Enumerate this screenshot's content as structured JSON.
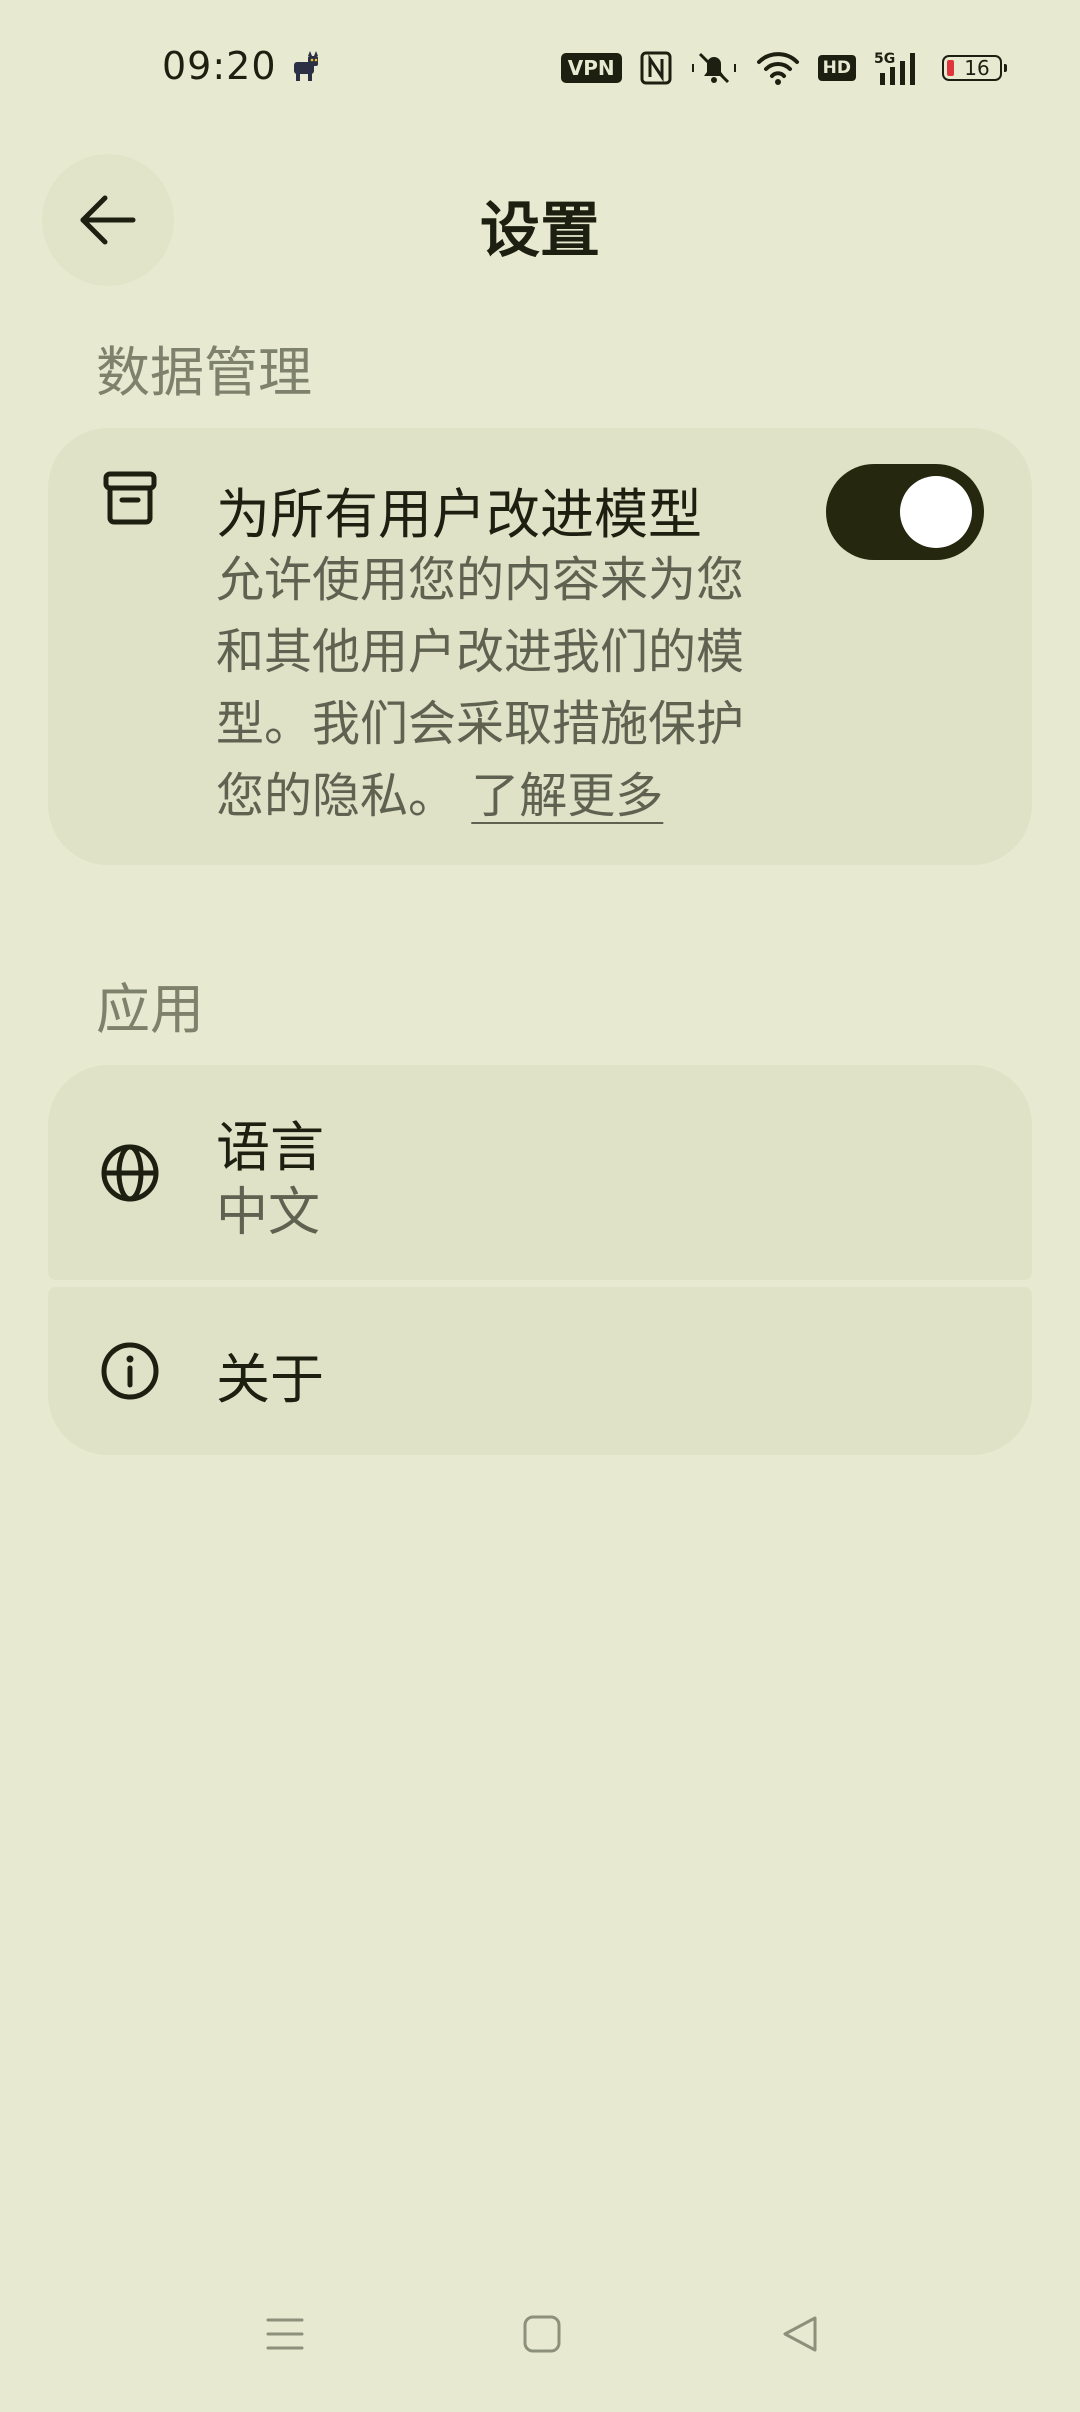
{
  "status_bar": {
    "time": "09:20",
    "vpn": "VPN",
    "hd": "HD",
    "network": "5G",
    "battery": "16",
    "icons": [
      "cat-icon",
      "nfc-icon",
      "mute-icon",
      "wifi-icon",
      "hd-icon",
      "signal-icon",
      "battery-icon"
    ]
  },
  "header": {
    "title": "设置",
    "back_icon": "arrow-left-icon"
  },
  "sections": {
    "data_management": {
      "header": "数据管理",
      "item": {
        "icon": "archive-icon",
        "title": "为所有用户改进模型",
        "description": " 允许使用您的内容来为您和其他用户改进我们的模型。我们会采取措施保护您的隐私。",
        "link": "了解更多",
        "toggle_on": true
      }
    },
    "app": {
      "header": "应用",
      "language": {
        "icon": "globe-icon",
        "title": "语言",
        "value": "中文"
      },
      "about": {
        "icon": "info-icon",
        "title": "关于"
      }
    }
  },
  "nav_bar": {
    "icons": [
      "menu-icon",
      "home-icon",
      "back-triangle-icon"
    ]
  },
  "colors": {
    "background": "#e7ead0",
    "card": "#dfe2c6",
    "text": "#1d1f10",
    "muted": "#7e816b",
    "toggle": "#25280f",
    "battery_low": "#e0363b"
  }
}
